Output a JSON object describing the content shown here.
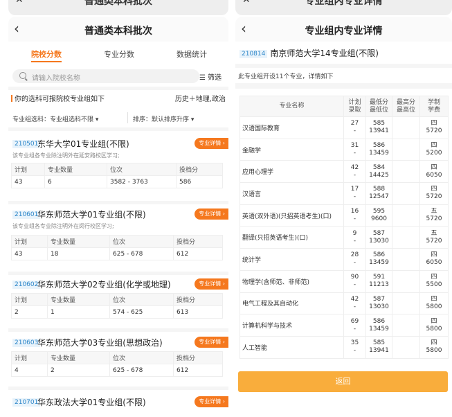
{
  "left": {
    "stub_title": "普通类本科批次",
    "title": "普通类本科批次",
    "tabs": [
      {
        "label": "院校分数"
      },
      {
        "label": "专业分数"
      },
      {
        "label": "数据统计"
      }
    ],
    "search_placeholder": "请输入院校名称",
    "filter_label": "筛选",
    "choice_left": "你的选科可报院校专业组如下",
    "choice_right": "历史＋地理,政治",
    "group_filter": "专业组选科：专业组选科不限",
    "sort_label": "排序：默认排序升序",
    "detail_button": "专业详情",
    "headers": [
      "计划",
      "专业数量",
      "位次",
      "投档分"
    ],
    "cards": [
      {
        "code": "210501",
        "name": "东华大学01专业组(不限)",
        "note": "该专业组各专业除注明外在延安路校区学习;",
        "plan": "43",
        "count": "6",
        "rank": "3582 - 3763",
        "score": "586"
      },
      {
        "code": "210601",
        "name": "华东师范大学01专业组(不限)",
        "note": "该专业组各专业除注明外在闵行校区学习;",
        "plan": "43",
        "count": "18",
        "rank": "625 - 678",
        "score": "612"
      },
      {
        "code": "210602",
        "name": "华东师范大学02专业组(化学或地理)",
        "note": "",
        "plan": "2",
        "count": "1",
        "rank": "574 - 625",
        "score": "613"
      },
      {
        "code": "210603",
        "name": "华东师范大学03专业组(思想政治)",
        "note": "",
        "plan": "4",
        "count": "2",
        "rank": "625 - 678",
        "score": "612"
      },
      {
        "code": "210701",
        "name": "华东政法大学01专业组(不限)",
        "note": "",
        "plan": "",
        "count": "",
        "rank": "",
        "score": ""
      }
    ]
  },
  "right": {
    "stub_title": "专业组内专业详情",
    "title": "专业组内专业详情",
    "group_code": "210814",
    "group_name": "南京师范大学14专业组(不限)",
    "info": "此专业组开设11个专业，详情如下",
    "headers": {
      "name": "专业名称",
      "plan_1": "计划",
      "plan_2": "录取",
      "min_1": "最低分",
      "min_2": "最低位",
      "max_1": "最高分",
      "max_2": "最高位",
      "fee_1": "学制",
      "fee_2": "学费"
    },
    "rows": [
      {
        "name": "汉语国际教育",
        "plan": "27",
        "adm": "-",
        "min": "585",
        "minrank": "13941",
        "max": "",
        "maxrank": "",
        "years": "四",
        "fee": "5720"
      },
      {
        "name": "金融学",
        "plan": "31",
        "adm": "-",
        "min": "586",
        "minrank": "13459",
        "max": "",
        "maxrank": "",
        "years": "四",
        "fee": "5200"
      },
      {
        "name": "应用心理学",
        "plan": "42",
        "adm": "-",
        "min": "584",
        "minrank": "14425",
        "max": "",
        "maxrank": "",
        "years": "四",
        "fee": "6050"
      },
      {
        "name": "汉语言",
        "plan": "17",
        "adm": "-",
        "min": "588",
        "minrank": "12547",
        "max": "",
        "maxrank": "",
        "years": "四",
        "fee": "5720"
      },
      {
        "name": "英语(双外语)(只招英语考生)(口)",
        "plan": "16",
        "adm": "-",
        "min": "595",
        "minrank": "9600",
        "max": "",
        "maxrank": "",
        "years": "五",
        "fee": "5720"
      },
      {
        "name": "翻译(只招英语考生)(口)",
        "plan": "9",
        "adm": "-",
        "min": "587",
        "minrank": "13030",
        "max": "",
        "maxrank": "",
        "years": "五",
        "fee": "5720"
      },
      {
        "name": "统计学",
        "plan": "28",
        "adm": "-",
        "min": "586",
        "minrank": "13459",
        "max": "",
        "maxrank": "",
        "years": "四",
        "fee": "6050"
      },
      {
        "name": "物理学(含师范、非师范)",
        "plan": "90",
        "adm": "-",
        "min": "591",
        "minrank": "11213",
        "max": "",
        "maxrank": "",
        "years": "四",
        "fee": "5500"
      },
      {
        "name": "电气工程及其自动化",
        "plan": "42",
        "adm": "-",
        "min": "587",
        "minrank": "13030",
        "max": "",
        "maxrank": "",
        "years": "四",
        "fee": "5800"
      },
      {
        "name": "计算机科学与技术",
        "plan": "69",
        "adm": "-",
        "min": "586",
        "minrank": "13459",
        "max": "",
        "maxrank": "",
        "years": "四",
        "fee": "5800"
      },
      {
        "name": "人工智能",
        "plan": "35",
        "adm": "-",
        "min": "585",
        "minrank": "13941",
        "max": "",
        "maxrank": "",
        "years": "四",
        "fee": "5800"
      }
    ],
    "return_label": "返回"
  }
}
